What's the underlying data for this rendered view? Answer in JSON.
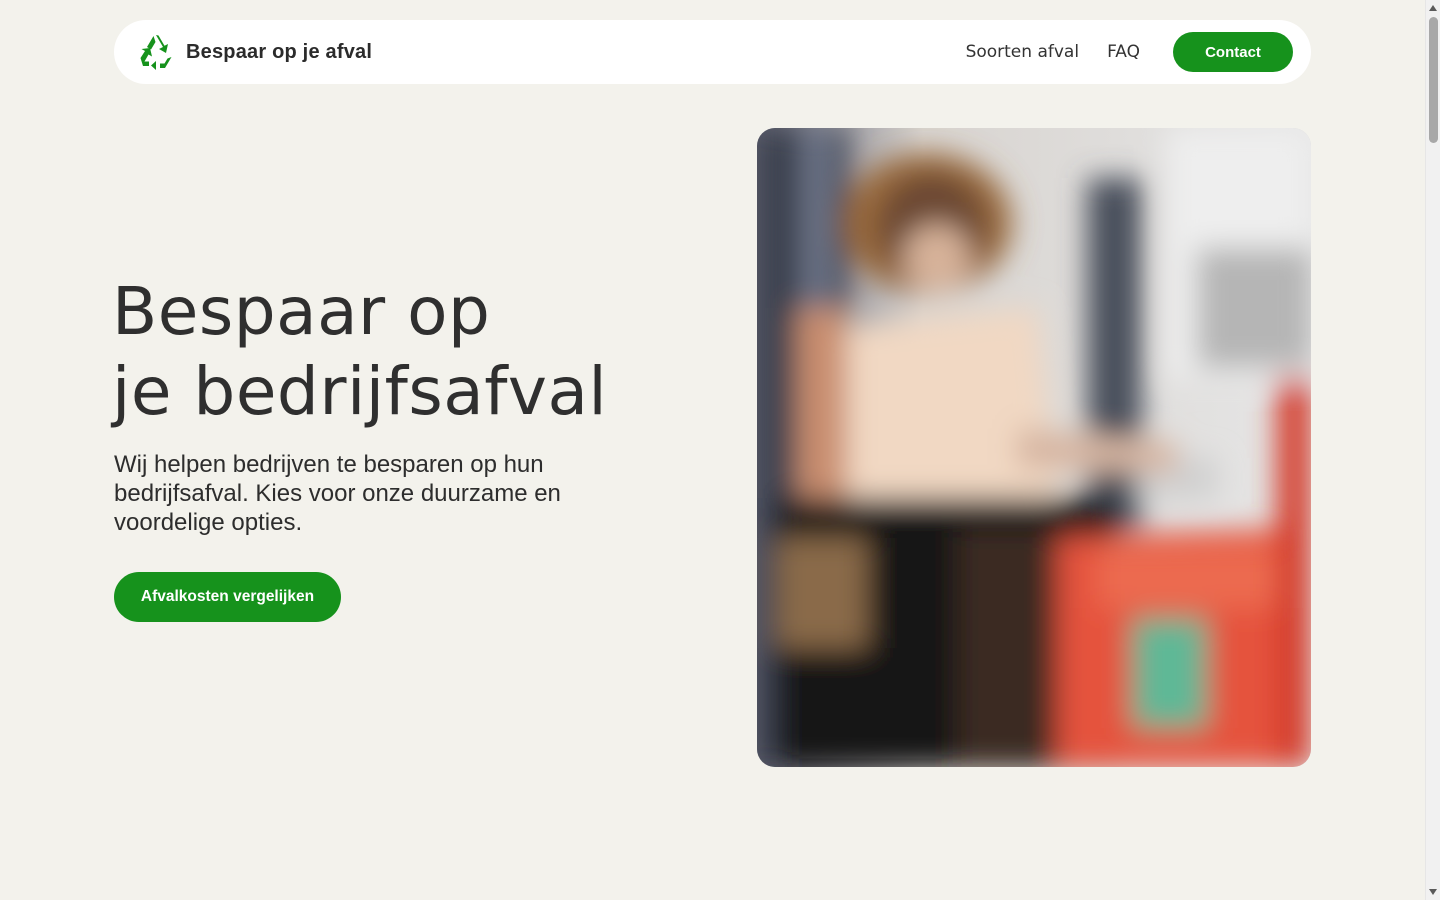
{
  "header": {
    "logo_icon": "recycle-icon",
    "site_name": "Bespaar op je afval",
    "nav": [
      {
        "label": "Soorten afval"
      },
      {
        "label": "FAQ"
      }
    ],
    "contact_label": "Contact"
  },
  "hero": {
    "title_line1": "Bespaar op",
    "title_line2": "je bedrijfsafval",
    "subtitle": "Wij helpen bedrijven te besparen op hun bedrijfsafval. Kies voor onze duurzame en voordelige opties.",
    "cta_label": "Afvalkosten vergelijken",
    "image": "blurred-photo-person-with-recycling-bin"
  },
  "colors": {
    "background": "#f3f2ec",
    "accent": "#16921c",
    "header_bg": "#ffffff",
    "text": "#2b2b2b"
  }
}
